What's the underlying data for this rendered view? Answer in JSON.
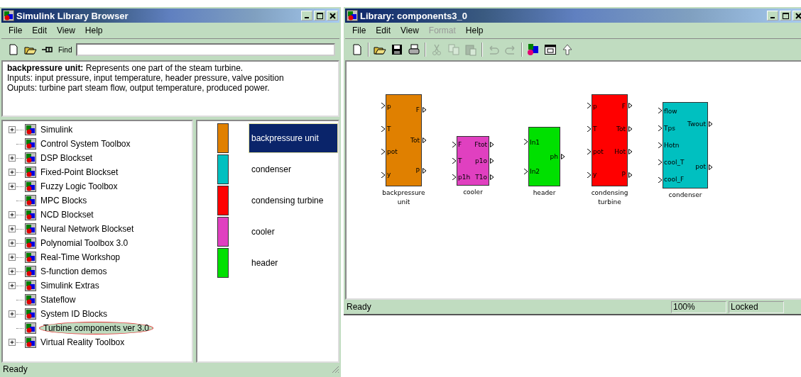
{
  "library_browser": {
    "title": "Simulink Library Browser",
    "menu": [
      "File",
      "Edit",
      "View",
      "Help"
    ],
    "toolbar": [
      {
        "kind": "new",
        "disabled": false
      },
      {
        "kind": "open",
        "disabled": false
      },
      {
        "kind": "pin",
        "disabled": false
      }
    ],
    "find_label": "Find",
    "description": [
      "**backpressure unit:** Represents one part of the steam turbine.",
      "Inputs: input pressure, input temperature, header pressure, valve position",
      "Ouputs: turbine part steam flow, output temperature, produced power."
    ],
    "tree": [
      {
        "label": "Simulink",
        "expandable": true,
        "selected": false,
        "circled": false
      },
      {
        "label": "Control System Toolbox",
        "expandable": false,
        "selected": false,
        "circled": false
      },
      {
        "label": "DSP Blockset",
        "expandable": true,
        "selected": false,
        "circled": false
      },
      {
        "label": "Fixed-Point Blockset",
        "expandable": true,
        "selected": false,
        "circled": false
      },
      {
        "label": "Fuzzy Logic Toolbox",
        "expandable": true,
        "selected": false,
        "circled": false
      },
      {
        "label": "MPC Blocks",
        "expandable": false,
        "selected": false,
        "circled": false
      },
      {
        "label": "NCD Blockset",
        "expandable": true,
        "selected": false,
        "circled": false
      },
      {
        "label": "Neural Network Blockset",
        "expandable": true,
        "selected": false,
        "circled": false
      },
      {
        "label": "Polynomial Toolbox 3.0",
        "expandable": true,
        "selected": false,
        "circled": false
      },
      {
        "label": "Real-Time Workshop",
        "expandable": true,
        "selected": false,
        "circled": false
      },
      {
        "label": "S-function demos",
        "expandable": true,
        "selected": false,
        "circled": false
      },
      {
        "label": "Simulink Extras",
        "expandable": true,
        "selected": false,
        "circled": false
      },
      {
        "label": "Stateflow",
        "expandable": false,
        "selected": false,
        "circled": false
      },
      {
        "label": "System ID Blocks",
        "expandable": true,
        "selected": false,
        "circled": false
      },
      {
        "label": "Turbine components ver 3.0",
        "expandable": false,
        "selected": true,
        "circled": true
      },
      {
        "label": "Virtual Reality Toolbox",
        "expandable": true,
        "selected": false,
        "circled": false
      }
    ],
    "blocks": [
      {
        "label": "backpressure unit",
        "selected": true,
        "color": "#e08000"
      },
      {
        "label": "condenser",
        "selected": false,
        "color": "#00c0c0"
      },
      {
        "label": "condensing turbine",
        "selected": false,
        "color": "#ff0000"
      },
      {
        "label": "cooler",
        "selected": false,
        "color": "#e040c0"
      },
      {
        "label": "header",
        "selected": false,
        "color": "#00e000"
      }
    ],
    "status": "Ready"
  },
  "library_window": {
    "title": "Library: components3_0",
    "menu": [
      {
        "label": "File",
        "disabled": false
      },
      {
        "label": "Edit",
        "disabled": false
      },
      {
        "label": "View",
        "disabled": false
      },
      {
        "label": "Format",
        "disabled": true
      },
      {
        "label": "Help",
        "disabled": false
      }
    ],
    "toolbar": [
      {
        "kind": "new",
        "disabled": false
      },
      {
        "kind": "sep"
      },
      {
        "kind": "open",
        "disabled": false
      },
      {
        "kind": "save",
        "disabled": false
      },
      {
        "kind": "print",
        "disabled": false
      },
      {
        "kind": "sep"
      },
      {
        "kind": "cut",
        "disabled": true
      },
      {
        "kind": "copy",
        "disabled": true
      },
      {
        "kind": "paste",
        "disabled": true
      },
      {
        "kind": "sep"
      },
      {
        "kind": "undo",
        "disabled": true
      },
      {
        "kind": "redo",
        "disabled": true
      },
      {
        "kind": "sep"
      },
      {
        "kind": "library",
        "disabled": false
      },
      {
        "kind": "browser",
        "disabled": false
      },
      {
        "kind": "up",
        "disabled": false
      }
    ],
    "canvas_blocks": [
      {
        "label": "backpressure unit",
        "color": "#e08000",
        "inputs": [
          "p",
          "T",
          "pot",
          "y"
        ],
        "outputs": [
          "F",
          "Tot",
          "P"
        ]
      },
      {
        "label": "cooler",
        "color": "#e040c0",
        "inputs": [
          "F",
          "T",
          "p1h"
        ],
        "outputs": [
          "Ftot",
          "p1o",
          "T1o"
        ]
      },
      {
        "label": "header",
        "color": "#00e000",
        "inputs": [
          "In1",
          "In2"
        ],
        "outputs": [
          "ph"
        ]
      },
      {
        "label": "condensing turbine",
        "color": "#ff0000",
        "inputs": [
          "p",
          "T",
          "pot",
          "y"
        ],
        "outputs": [
          "F",
          "Tot",
          "Hot",
          "P"
        ]
      },
      {
        "label": "condenser",
        "color": "#00c0c0",
        "inputs": [
          "flow",
          "Tps",
          "Hotn",
          "cool_T",
          "cool_F"
        ],
        "outputs": [
          "Twout",
          "pot"
        ]
      }
    ],
    "status": {
      "text": "Ready",
      "zoom": "100%",
      "lock": "Locked"
    }
  }
}
